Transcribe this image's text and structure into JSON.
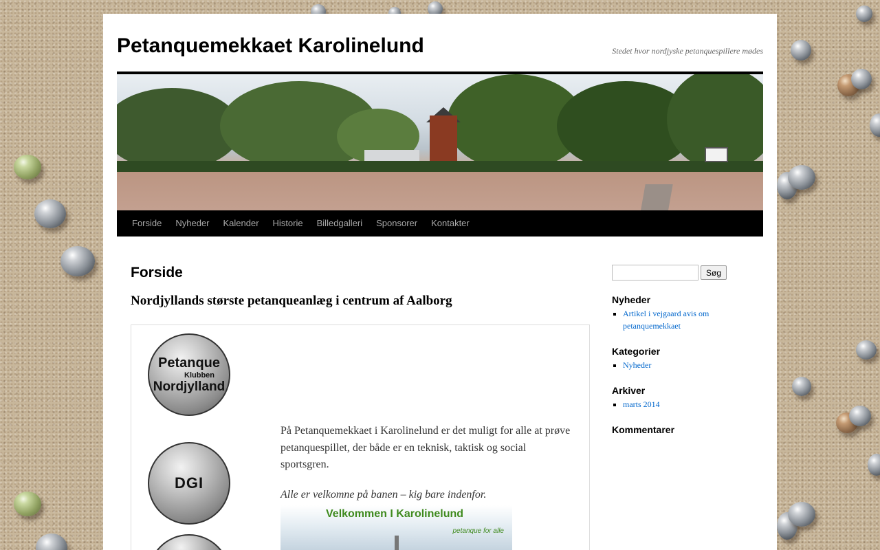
{
  "site": {
    "title": "Petanquemekkaet Karolinelund",
    "description": "Stedet hvor nordjyske petanquespillere mødes"
  },
  "nav": {
    "items": [
      {
        "label": "Forside"
      },
      {
        "label": "Nyheder"
      },
      {
        "label": "Kalender"
      },
      {
        "label": "Historie"
      },
      {
        "label": "Billedgalleri"
      },
      {
        "label": "Sponsorer"
      },
      {
        "label": "Kontakter"
      }
    ]
  },
  "page": {
    "title": "Forside",
    "subtitle": "Nordjyllands største petanqueanlæg i centrum af Aalborg",
    "logo1": {
      "line1": "Petanque",
      "line2": "Klubben",
      "line3": "Nordjylland"
    },
    "logo2": {
      "text": "DGI"
    },
    "intro": "På Petanquemekkaet i Karolinelund er det muligt for alle at prøve petanquespillet, der  både er en teknisk, taktisk og social sportsgren.",
    "welcome": "Alle er velkomne på banen – kig bare indenfor.",
    "welcome_image": {
      "title": "Velkommen I Karolinelund",
      "tagline": "petanque for alle"
    }
  },
  "sidebar": {
    "search_button": "Søg",
    "widgets": [
      {
        "title": "Nyheder",
        "items": [
          "Artikel i vejgaard avis om petanquemekkaet"
        ]
      },
      {
        "title": "Kategorier",
        "items": [
          "Nyheder"
        ]
      },
      {
        "title": "Arkiver",
        "items": [
          "marts 2014"
        ]
      },
      {
        "title": "Kommentarer",
        "items": []
      }
    ]
  },
  "colors": {
    "nav_bg": "#000000",
    "nav_text": "#aaaaaa",
    "link": "#0066cc"
  }
}
